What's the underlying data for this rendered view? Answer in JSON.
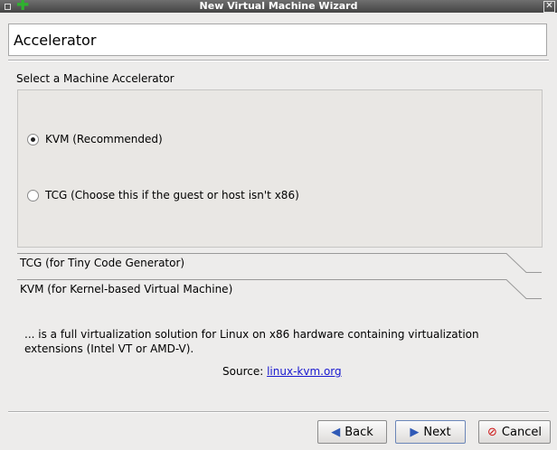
{
  "window": {
    "title": "New Virtual Machine Wizard"
  },
  "header": {
    "title": "Accelerator"
  },
  "group": {
    "label": "Select a Machine Accelerator"
  },
  "options": [
    {
      "label": "KVM (Recommended)",
      "selected": true
    },
    {
      "label": "TCG (Choose this if the guest or host isn't x86)",
      "selected": false
    }
  ],
  "tabs": [
    {
      "label": "TCG (for Tiny Code Generator)"
    },
    {
      "label": "KVM (for Kernel-based Virtual Machine)"
    }
  ],
  "description": "... is a full virtualization solution for Linux on x86 hardware containing virtualization extensions (Intel VT or AMD-V).",
  "source": {
    "prefix": "Source:",
    "link": "linux-kvm.org"
  },
  "buttons": {
    "back": "Back",
    "next": "Next",
    "cancel": "Cancel"
  },
  "colors": {
    "next_icon": "#2f59b6",
    "back_icon": "#2f59b6",
    "cancel_icon": "#cc1111",
    "add_icon": "#2fb12f"
  }
}
